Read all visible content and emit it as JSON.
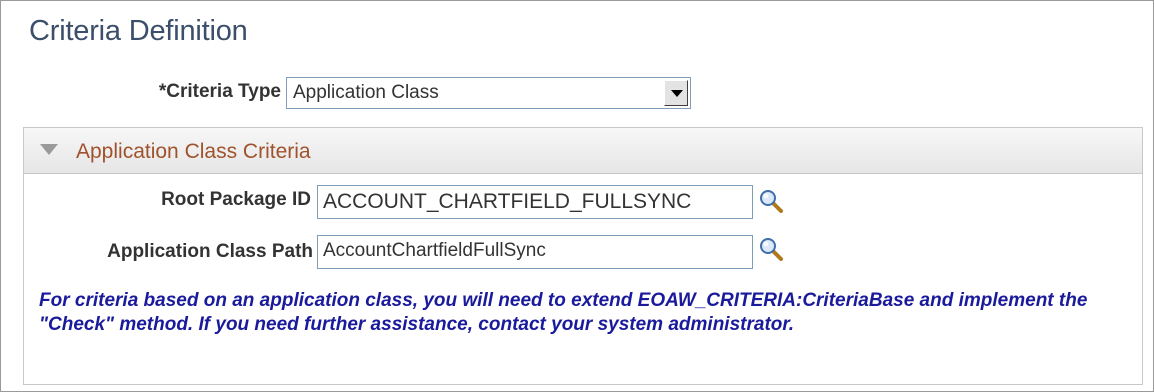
{
  "page": {
    "title": "Criteria Definition"
  },
  "criteria_type": {
    "label": "*Criteria Type",
    "value": "Application Class"
  },
  "group": {
    "title": "Application Class Criteria",
    "root_package": {
      "label": "Root Package ID",
      "value": "ACCOUNT_CHARTFIELD_FULLSYNC"
    },
    "app_class_path": {
      "label": "Application Class Path",
      "value": "AccountChartfieldFullSync"
    },
    "note": "For criteria based on an application class, you will need to extend EOAW_CRITERIA:CriteriaBase and implement the \"Check\" method. If you need further assistance, contact your system administrator."
  },
  "colors": {
    "title": "#3b4f6b",
    "group_title": "#a0522d",
    "note": "#1a1a9c"
  },
  "icons": [
    "chevron-down-icon",
    "collapse-triangle-icon",
    "magnifier-icon"
  ]
}
